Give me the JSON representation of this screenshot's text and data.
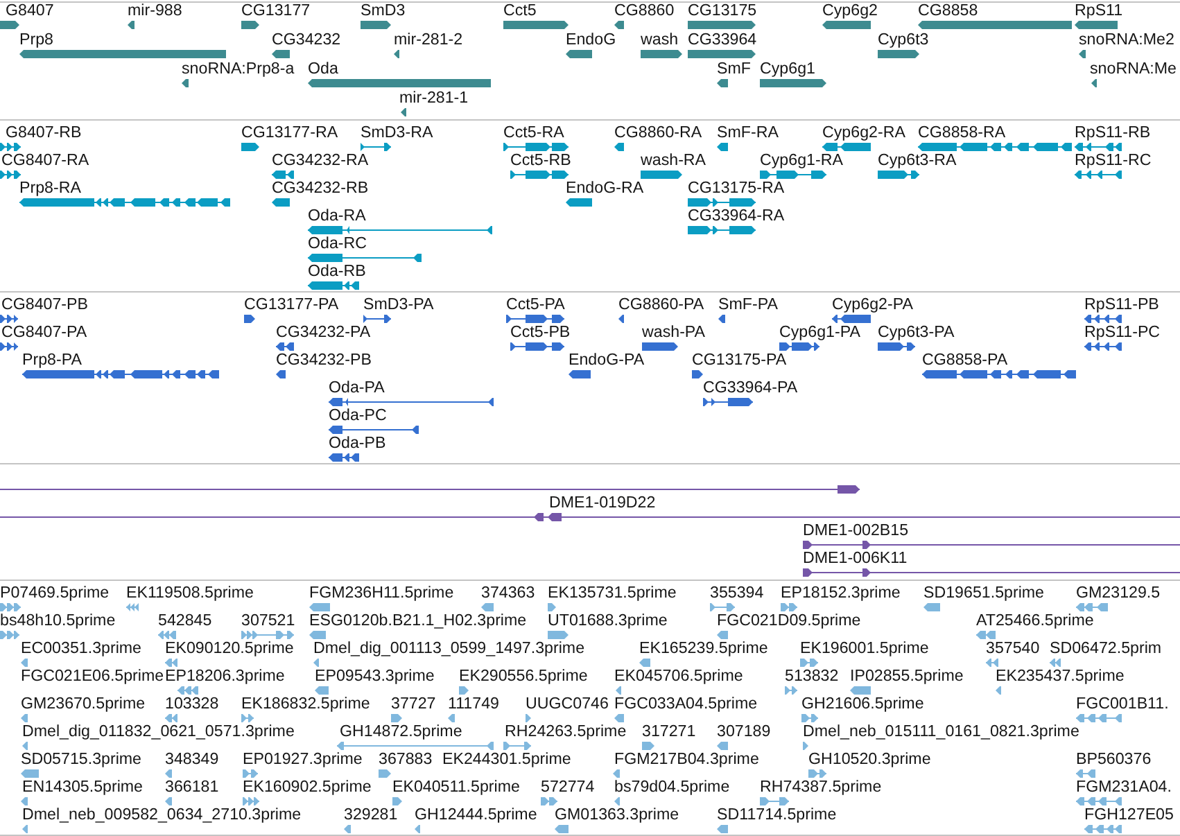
{
  "tracks": [
    {
      "kind": "gene",
      "rows": [
        {
          "features": [
            {
              "name": "G8407",
              "reverse": false
            },
            {
              "name": "mir-988",
              "reverse": true
            },
            {
              "name": "CG13177",
              "reverse": false
            },
            {
              "name": "SmD3",
              "reverse": false
            },
            {
              "name": "Cct5",
              "reverse": false
            },
            {
              "name": "CG8860",
              "reverse": true
            },
            {
              "name": "CG13175",
              "reverse": false
            },
            {
              "name": "Cyp6g2",
              "reverse": true
            },
            {
              "name": "CG8858",
              "reverse": true
            },
            {
              "name": "RpS11",
              "reverse": true
            }
          ]
        },
        {
          "features": [
            {
              "name": "Prp8",
              "reverse": true
            },
            {
              "name": "CG34232",
              "reverse": true
            },
            {
              "name": "mir-281-2",
              "reverse": true
            },
            {
              "name": "EndoG",
              "reverse": true
            },
            {
              "name": "wash",
              "reverse": false
            },
            {
              "name": "CG33964",
              "reverse": false
            },
            {
              "name": "Cyp6t3",
              "reverse": false
            },
            {
              "name": "snoRNA:Me2",
              "reverse": true
            }
          ]
        },
        {
          "features": [
            {
              "name": "snoRNA:Prp8-a",
              "reverse": true
            },
            {
              "name": "Oda",
              "reverse": true
            },
            {
              "name": "SmF",
              "reverse": true
            },
            {
              "name": "Cyp6g1",
              "reverse": false
            },
            {
              "name": "snoRNA:Me",
              "reverse": true
            }
          ]
        },
        {
          "features": [
            {
              "name": "mir-281-1",
              "reverse": true
            }
          ]
        }
      ]
    },
    {
      "kind": "transcript",
      "rows": [
        {
          "features": [
            {
              "name": "G8407-RB",
              "reverse": false
            },
            {
              "name": "CG13177-RA",
              "reverse": false
            },
            {
              "name": "SmD3-RA",
              "reverse": false
            },
            {
              "name": "Cct5-RA",
              "reverse": false
            },
            {
              "name": "CG8860-RA",
              "reverse": true
            },
            {
              "name": "SmF-RA",
              "reverse": true
            },
            {
              "name": "Cyp6g2-RA",
              "reverse": true
            },
            {
              "name": "CG8858-RA",
              "reverse": true
            },
            {
              "name": "RpS11-RB",
              "reverse": true
            }
          ]
        },
        {
          "features": [
            {
              "name": "CG8407-RA",
              "reverse": false
            },
            {
              "name": "CG34232-RA",
              "reverse": true
            },
            {
              "name": "Cct5-RB",
              "reverse": false
            },
            {
              "name": "wash-RA",
              "reverse": false
            },
            {
              "name": "Cyp6g1-RA",
              "reverse": false
            },
            {
              "name": "Cyp6t3-RA",
              "reverse": false
            },
            {
              "name": "RpS11-RC",
              "reverse": true
            }
          ]
        },
        {
          "features": [
            {
              "name": "Prp8-RA",
              "reverse": true
            },
            {
              "name": "CG34232-RB",
              "reverse": true
            },
            {
              "name": "EndoG-RA",
              "reverse": true
            },
            {
              "name": "CG13175-RA",
              "reverse": false
            }
          ]
        },
        {
          "features": [
            {
              "name": "Oda-RA",
              "reverse": true
            },
            {
              "name": "CG33964-RA",
              "reverse": false
            }
          ]
        },
        {
          "features": [
            {
              "name": "Oda-RC",
              "reverse": true
            }
          ]
        },
        {
          "features": [
            {
              "name": "Oda-RB",
              "reverse": true
            }
          ]
        }
      ]
    },
    {
      "kind": "protein",
      "rows": [
        {
          "features": [
            {
              "name": "CG8407-PB",
              "reverse": false
            },
            {
              "name": "CG13177-PA",
              "reverse": false
            },
            {
              "name": "SmD3-PA",
              "reverse": false
            },
            {
              "name": "Cct5-PA",
              "reverse": false
            },
            {
              "name": "CG8860-PA",
              "reverse": true
            },
            {
              "name": "SmF-PA",
              "reverse": true
            },
            {
              "name": "Cyp6g2-PA",
              "reverse": true
            },
            {
              "name": "RpS11-PB",
              "reverse": true
            }
          ]
        },
        {
          "features": [
            {
              "name": "CG8407-PA",
              "reverse": false
            },
            {
              "name": "CG34232-PA",
              "reverse": true
            },
            {
              "name": "Cct5-PB",
              "reverse": false
            },
            {
              "name": "wash-PA",
              "reverse": false
            },
            {
              "name": "Cyp6g1-PA",
              "reverse": false
            },
            {
              "name": "Cyp6t3-PA",
              "reverse": false
            },
            {
              "name": "RpS11-PC",
              "reverse": true
            }
          ]
        },
        {
          "features": [
            {
              "name": "Prp8-PA",
              "reverse": true
            },
            {
              "name": "CG34232-PB",
              "reverse": true
            },
            {
              "name": "EndoG-PA",
              "reverse": true
            },
            {
              "name": "CG13175-PA",
              "reverse": false
            },
            {
              "name": "CG8858-PA",
              "reverse": true
            }
          ]
        },
        {
          "features": [
            {
              "name": "Oda-PA",
              "reverse": true
            },
            {
              "name": "CG33964-PA",
              "reverse": false
            }
          ]
        },
        {
          "features": [
            {
              "name": "Oda-PC",
              "reverse": true
            }
          ]
        },
        {
          "features": [
            {
              "name": "Oda-PB",
              "reverse": true
            }
          ]
        }
      ]
    },
    {
      "kind": "clone",
      "rows": [
        {
          "features": [
            {
              "reverse": false
            }
          ]
        },
        {
          "features": [
            {
              "name": "DME1-019D22",
              "reverse": true
            }
          ]
        },
        {
          "features": [
            {
              "name": "DME1-002B15",
              "reverse": false
            }
          ]
        },
        {
          "features": [
            {
              "name": "DME1-006K11",
              "reverse": false
            }
          ]
        }
      ]
    },
    {
      "kind": "est",
      "rows": [
        {
          "features": [
            {
              "name": "P07469.5prime",
              "reverse": false
            },
            {
              "name": "EK119508.5prime",
              "reverse": true
            },
            {
              "name": "FGM236H11.5prime",
              "reverse": true
            },
            {
              "name": "374363",
              "reverse": true
            },
            {
              "name": "EK135731.5prime",
              "reverse": false
            },
            {
              "name": "355394",
              "reverse": false
            },
            {
              "name": "EP18152.3prime",
              "reverse": false
            },
            {
              "name": "SD19651.5prime",
              "reverse": true
            },
            {
              "name": "GM23129.5",
              "reverse": true
            }
          ]
        },
        {
          "features": [
            {
              "name": "bs48h10.5prime",
              "reverse": false
            },
            {
              "name": "542845",
              "reverse": true
            },
            {
              "name": "307521",
              "reverse": false
            },
            {
              "name": "ESG0120b.B21.1_H02.3prime",
              "reverse": true
            },
            {
              "name": "UT01688.3prime",
              "reverse": false
            },
            {
              "name": "FGC021D09.5prime",
              "reverse": true
            },
            {
              "name": "AT25466.5prime",
              "reverse": true
            }
          ]
        },
        {
          "features": [
            {
              "name": "EC00351.3prime",
              "reverse": true
            },
            {
              "name": "EK090120.5prime",
              "reverse": true
            },
            {
              "name": "Dmel_dig_001113_0599_1497.3prime",
              "reverse": true
            },
            {
              "name": "EK165239.5prime",
              "reverse": true
            },
            {
              "name": "EK196001.5prime",
              "reverse": false
            },
            {
              "name": "357540",
              "reverse": true
            },
            {
              "name": "SD06472.5prim",
              "reverse": true
            }
          ]
        },
        {
          "features": [
            {
              "name": "FGC021E06.5prime"
            },
            {
              "name": "EP18206.3prime",
              "reverse": true
            },
            {
              "name": "EP09543.3prime",
              "reverse": true
            },
            {
              "name": "EK290556.5prime",
              "reverse": false
            },
            {
              "name": "EK045706.5prime",
              "reverse": true
            },
            {
              "name": "513832",
              "reverse": false
            },
            {
              "name": "IP02855.5prime",
              "reverse": true
            },
            {
              "name": "EK235437.5prime",
              "reverse": true
            }
          ]
        },
        {
          "features": [
            {
              "name": "GM23670.5prime",
              "reverse": true
            },
            {
              "name": "103328",
              "reverse": true
            },
            {
              "name": "EK186832.5prime",
              "reverse": false
            },
            {
              "name": "37727",
              "reverse": false
            },
            {
              "name": "111749",
              "reverse": true
            },
            {
              "name": "UUGC0746",
              "reverse": false
            },
            {
              "name": "FGC033A04.5prime",
              "reverse": true
            },
            {
              "name": "GH21606.5prime",
              "reverse": false
            },
            {
              "name": "FGC001B11.",
              "reverse": true
            }
          ]
        },
        {
          "features": [
            {
              "name": "Dmel_dig_011832_0621_0571.3prime",
              "reverse": true
            },
            {
              "name": "GH14872.5prime",
              "reverse": true
            },
            {
              "name": "RH24263.5prime",
              "reverse": false
            },
            {
              "name": "317271",
              "reverse": false
            },
            {
              "name": "307189",
              "reverse": true
            },
            {
              "name": "Dmel_neb_015111_0161_0821.3prime",
              "reverse": false
            }
          ]
        },
        {
          "features": [
            {
              "name": "SD05715.3prime",
              "reverse": true
            },
            {
              "name": "348349",
              "reverse": true
            },
            {
              "name": "EP01927.3prime",
              "reverse": false
            },
            {
              "name": "367883",
              "reverse": false
            },
            {
              "name": "EK244301.5prime"
            },
            {
              "name": "FGM217B04.3prime",
              "reverse": true
            },
            {
              "name": "GH10520.3prime",
              "reverse": false
            },
            {
              "name": "BP560376",
              "reverse": true
            }
          ]
        },
        {
          "features": [
            {
              "name": "EN14305.5prime",
              "reverse": true
            },
            {
              "name": "366181",
              "reverse": true
            },
            {
              "name": "EK160902.5prime",
              "reverse": false
            },
            {
              "name": "EK040511.5prime",
              "reverse": false
            },
            {
              "name": "572774",
              "reverse": false
            },
            {
              "name": "bs79d04.5prime",
              "reverse": true
            },
            {
              "name": "RH74387.5prime",
              "reverse": false
            },
            {
              "name": "FGM231A04.",
              "reverse": true
            }
          ]
        },
        {
          "features": [
            {
              "name": "Dmel_neb_009582_0634_2710.3prime",
              "reverse": true
            },
            {
              "name": "329281",
              "reverse": true
            },
            {
              "name": "GH12444.5prime",
              "reverse": true
            },
            {
              "name": "GM01363.3prime",
              "reverse": true
            },
            {
              "name": "SD11714.5prime",
              "reverse": true
            },
            {
              "name": "FGH127E05",
              "reverse": true
            }
          ]
        }
      ]
    }
  ]
}
